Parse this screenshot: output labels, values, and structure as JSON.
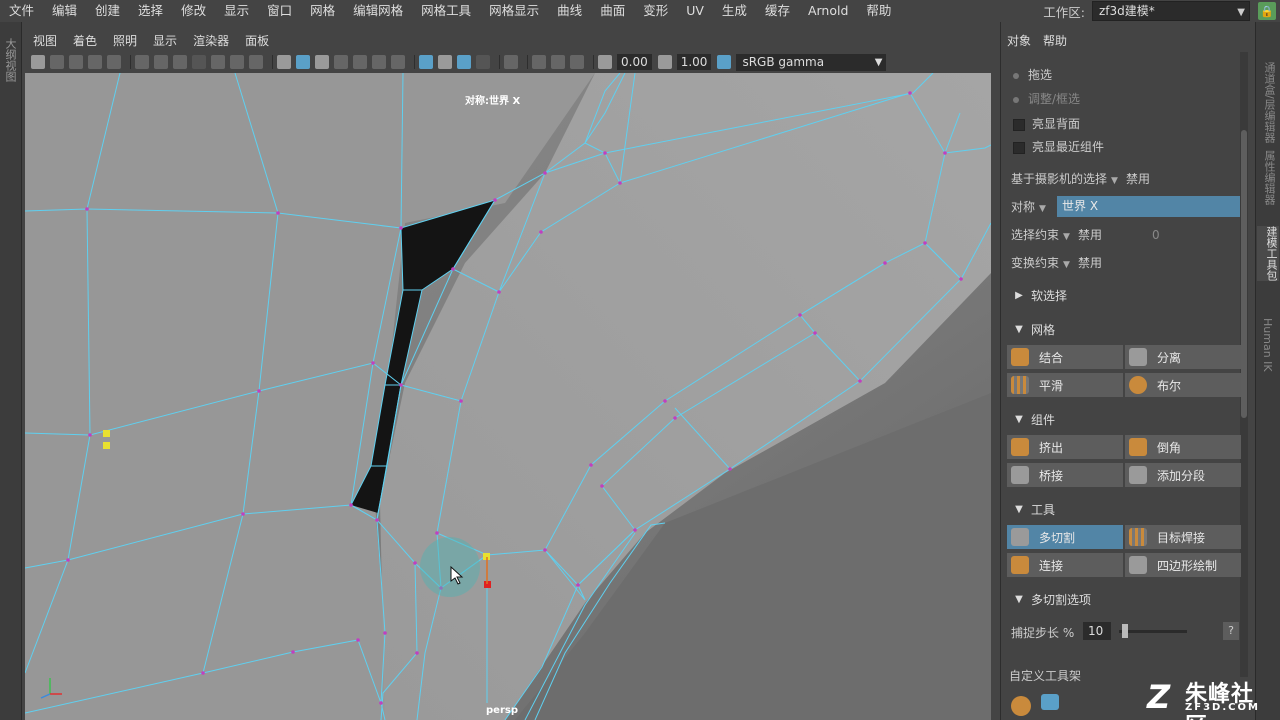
{
  "menubar": {
    "items": [
      "文件",
      "编辑",
      "创建",
      "选择",
      "修改",
      "显示",
      "窗口",
      "网格",
      "编辑网格",
      "网格工具",
      "网格显示",
      "曲线",
      "曲面",
      "变形",
      "UV",
      "生成",
      "缓存",
      "Arnold",
      "帮助"
    ],
    "workspace_label": "工作区:",
    "workspace_value": "zf3d建模*"
  },
  "left_strip": {
    "tab": "大纲视图"
  },
  "viewport": {
    "menu": [
      "视图",
      "着色",
      "照明",
      "显示",
      "渲染器",
      "面板"
    ],
    "toolbar": {
      "value_a": "0.00",
      "value_b": "1.00",
      "color_space": "sRGB gamma"
    },
    "symmetry_label": "对称:世界 X",
    "camera_label": "persp"
  },
  "right_panel": {
    "menu": [
      "对象",
      "帮助"
    ],
    "drag_select": "拖选",
    "adjust_select": "调整/框选",
    "backface": "亮显背面",
    "nearest": "亮显最近组件",
    "camera_based": {
      "label": "基于摄影机的选择",
      "value": "禁用"
    },
    "symmetry": {
      "label": "对称",
      "value": "世界 X"
    },
    "select_constraint": {
      "label": "选择约束",
      "value": "禁用",
      "extra": "0"
    },
    "transform_constraint": {
      "label": "变换约束",
      "value": "禁用"
    },
    "soft_select": "软选择",
    "sections": {
      "mesh": {
        "title": "网格",
        "buttons": [
          "结合",
          "分离",
          "平滑",
          "布尔"
        ]
      },
      "component": {
        "title": "组件",
        "buttons": [
          "挤出",
          "倒角",
          "桥接",
          "添加分段"
        ]
      },
      "tools": {
        "title": "工具",
        "buttons": [
          "多切割",
          "目标焊接",
          "连接",
          "四边形绘制"
        ]
      },
      "multicut": {
        "title": "多切割选项",
        "snap_label": "捕捉步长 %",
        "snap_value": "10",
        "help": "?"
      }
    },
    "custom_shelf": "自定义工具架"
  },
  "right_tabs": [
    "通道盒/层编辑器",
    "属性编辑器",
    "建模工具包",
    "Human IK"
  ],
  "watermark": {
    "main": "朱峰社区",
    "sub": "ZF3D.COM"
  },
  "colors": {
    "accent": "#5285a6",
    "wire": "#5fd0f0",
    "vertex": "#c040c0",
    "face": "#141414"
  }
}
